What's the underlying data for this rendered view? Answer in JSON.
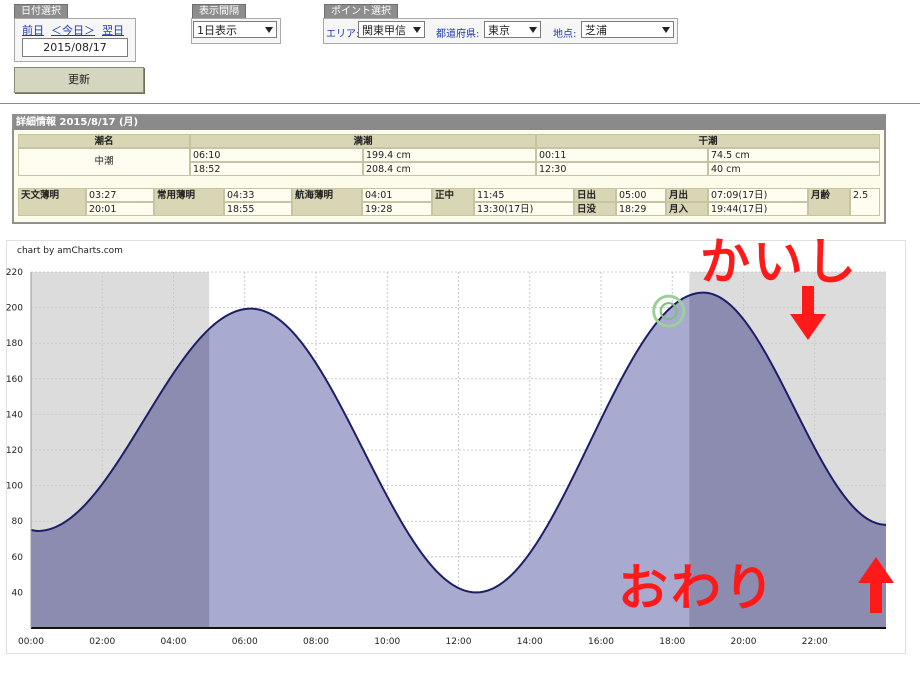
{
  "date_panel": {
    "title": "日付選択",
    "prev": "前日",
    "today": "＜今日＞",
    "next": "翌日",
    "date": "2015/08/17"
  },
  "interval_panel": {
    "title": "表示間隔",
    "value": "1日表示"
  },
  "point_panel": {
    "title": "ポイント選択",
    "area_label": "エリア:",
    "area_value": "関東甲信",
    "pref_label": "都道府県:",
    "pref_value": "東京",
    "place_label": "地点:",
    "place_value": "芝浦"
  },
  "update_button": "更新",
  "detail": {
    "header": "詳細情報  2015/8/17 (月)",
    "tide_name_label": "潮名",
    "tide_name": "中潮",
    "high_label": "満潮",
    "low_label": "干潮",
    "high": [
      {
        "time": "06:10",
        "height": "199.4 cm"
      },
      {
        "time": "18:52",
        "height": "208.4 cm"
      }
    ],
    "low": [
      {
        "time": "00:11",
        "height": "74.5 cm"
      },
      {
        "time": "12:30",
        "height": "40 cm"
      }
    ],
    "astro": {
      "label_1": "天文薄明",
      "v1a": "03:27",
      "v1b": "20:01",
      "label_2": "常用薄明",
      "v2a": "04:33",
      "v2b": "18:55",
      "label_3": "航海薄明",
      "v3a": "04:01",
      "v3b": "19:28",
      "label_4": "正中",
      "v4a": "11:45",
      "v4b": "13:30(17日)",
      "label_sunrise": "日出",
      "sunrise": "05:00",
      "label_sunset": "日没",
      "sunset": "18:29",
      "label_moonrise": "月出",
      "moonrise": "07:09(17日)",
      "label_moonset": "月入",
      "moonset": "19:44(17日)",
      "label_age": "月齢",
      "age": "2.5"
    }
  },
  "chart_credit": "chart by amCharts.com",
  "chart_data": {
    "type": "area",
    "title": "",
    "xlabel": "",
    "ylabel": "",
    "x_unit": "hours",
    "xlim": [
      0,
      24
    ],
    "ylim": [
      20,
      220
    ],
    "y_ticks": [
      40,
      60,
      80,
      100,
      120,
      140,
      160,
      180,
      200,
      220
    ],
    "x_ticks": [
      "00:00",
      "02:00",
      "04:00",
      "06:00",
      "08:00",
      "10:00",
      "12:00",
      "14:00",
      "16:00",
      "18:00",
      "20:00",
      "22:00"
    ],
    "grid": true,
    "x": [
      0,
      0.18,
      6.17,
      12.5,
      18.87,
      24
    ],
    "values": [
      75,
      74.5,
      199.4,
      40,
      208.4,
      78
    ],
    "night_shade": [
      [
        0,
        5.0
      ],
      [
        18.48,
        24
      ]
    ],
    "marker": {
      "x": 17.9,
      "y": 198
    },
    "colors": {
      "line": "#1d1f66",
      "area": "#a9aad0",
      "night_area": "#8b8cb0",
      "night_bg": "#dcdcdc"
    }
  },
  "annotations": {
    "top": "かいし",
    "bottom": "おわり",
    "color": "#ff1a1a"
  }
}
